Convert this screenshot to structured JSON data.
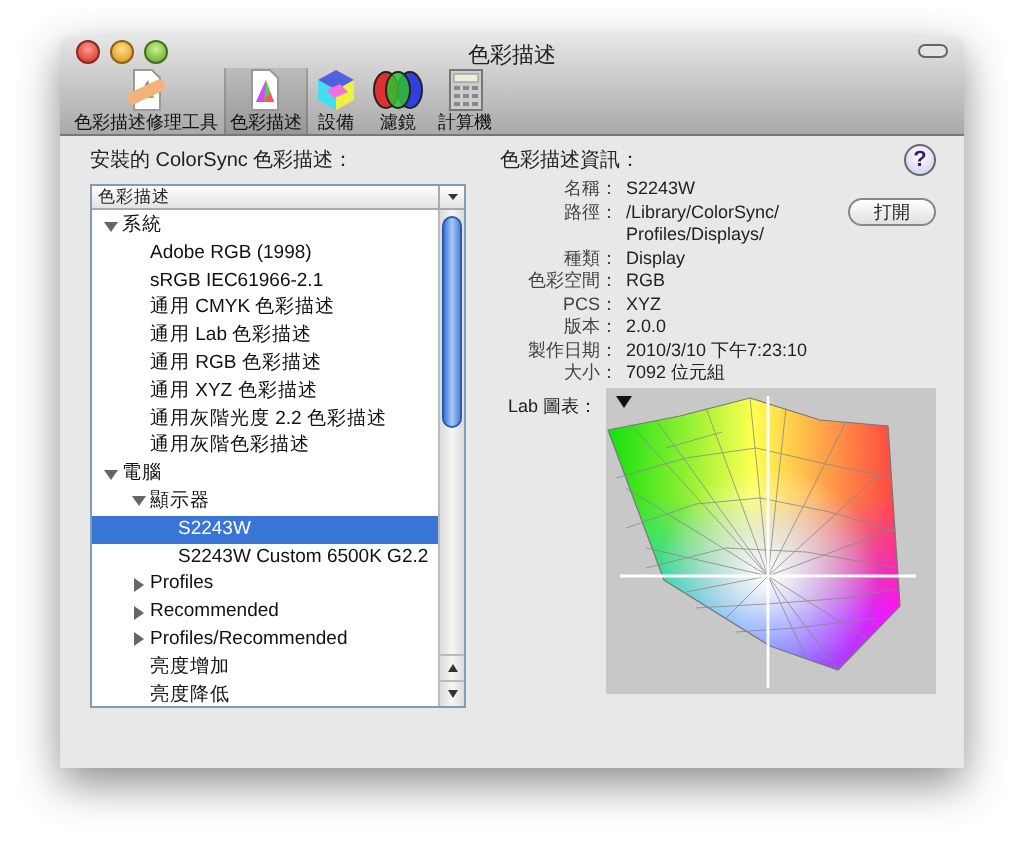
{
  "window": {
    "title": "色彩描述"
  },
  "toolbar": [
    {
      "label": "色彩描述修理工具",
      "kind": "repair",
      "selected": false
    },
    {
      "label": "色彩描述",
      "kind": "profile",
      "selected": true
    },
    {
      "label": "設備",
      "kind": "devices",
      "selected": false
    },
    {
      "label": "濾鏡",
      "kind": "filters",
      "selected": false
    },
    {
      "label": "計算機",
      "kind": "calculator",
      "selected": false
    }
  ],
  "profiles_panel": {
    "title": "安裝的 ColorSync 色彩描述：",
    "column_header": "色彩描述",
    "tree": [
      {
        "label": "系統",
        "expanded": true,
        "selected": false,
        "children": [
          {
            "label": "Adobe RGB (1998)",
            "selected": false
          },
          {
            "label": "sRGB IEC61966-2.1",
            "selected": false
          },
          {
            "label": "通用 CMYK 色彩描述",
            "selected": false
          },
          {
            "label": "通用 Lab 色彩描述",
            "selected": false
          },
          {
            "label": "通用 RGB 色彩描述",
            "selected": false
          },
          {
            "label": "通用 XYZ 色彩描述",
            "selected": false
          },
          {
            "label": "通用灰階光度 2.2 色彩描述",
            "selected": false
          },
          {
            "label": "通用灰階色彩描述",
            "selected": false
          }
        ]
      },
      {
        "label": "電腦",
        "expanded": true,
        "selected": false,
        "children": [
          {
            "label": "顯示器",
            "expanded": true,
            "selected": false,
            "children": [
              {
                "label": "S2243W",
                "selected": true
              },
              {
                "label": "S2243W Custom 6500K G2.2",
                "selected": false
              }
            ]
          },
          {
            "label": "Profiles",
            "expanded": false,
            "selected": false
          },
          {
            "label": "Recommended",
            "expanded": false,
            "selected": false
          },
          {
            "label": "Profiles/Recommended",
            "expanded": false,
            "selected": false
          },
          {
            "label": "亮度增加",
            "selected": false
          },
          {
            "label": "亮度降低",
            "selected": false
          }
        ]
      }
    ]
  },
  "info_panel": {
    "title": "色彩描述資訊：",
    "help": "?",
    "open_button": "打開",
    "fields": [
      {
        "label": "名稱：",
        "value": "S2243W"
      },
      {
        "label": "路徑：",
        "value": "/Library/ColorSync/ Profiles/Displays/"
      },
      {
        "label": "種類：",
        "value": "Display"
      },
      {
        "label": "色彩空間：",
        "value": "RGB"
      },
      {
        "label": "PCS：",
        "value": "XYZ"
      },
      {
        "label": "版本：",
        "value": "2.0.0"
      },
      {
        "label": "製作日期：",
        "value": "2010/3/10 下午7:23:10"
      },
      {
        "label": "大小：",
        "value": "7092 位元組"
      }
    ],
    "lab_label": "Lab 圖表："
  }
}
